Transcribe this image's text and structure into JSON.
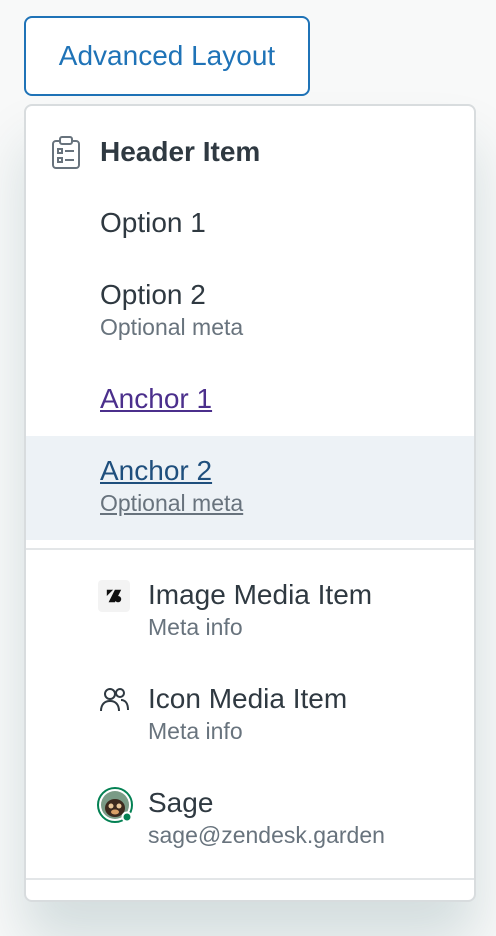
{
  "trigger": {
    "label": "Advanced Layout"
  },
  "menu": {
    "header": {
      "label": "Header Item",
      "icon": "clipboard-list-icon"
    },
    "options": [
      {
        "label": "Option 1"
      },
      {
        "label": "Option 2",
        "meta": "Optional meta"
      }
    ],
    "anchors": [
      {
        "label": "Anchor 1"
      },
      {
        "label": "Anchor 2",
        "meta": "Optional meta"
      }
    ],
    "media_items": [
      {
        "label": "Image Media Item",
        "meta": "Meta info",
        "icon": "zendesk-logo-icon"
      },
      {
        "label": "Icon Media Item",
        "meta": "Meta info",
        "icon": "users-icon"
      },
      {
        "label": "Sage",
        "meta": "sage@zendesk.garden",
        "icon": "avatar",
        "status": "online"
      }
    ]
  },
  "colors": {
    "accent": "#1f73b7",
    "text": "#2f3941",
    "meta": "#68737d",
    "hover_bg": "#edf2f6",
    "visited_link": "#4b2f8c",
    "status_online": "#038153"
  }
}
